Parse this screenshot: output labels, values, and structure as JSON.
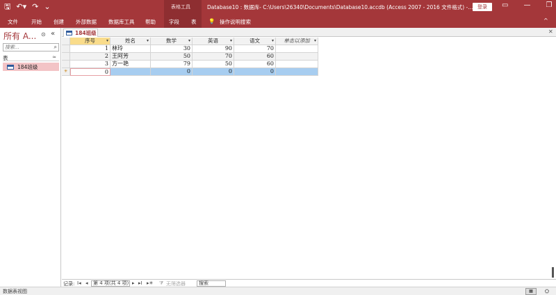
{
  "titlebar": {
    "qat_icons": [
      "save-icon",
      "undo-icon",
      "redo-icon",
      "customize-icon"
    ],
    "qat_glyphs": [
      "🖫",
      "↶▾",
      "↷",
      "⌄"
    ],
    "context_tools": "表格工具",
    "title": "Database10 : 数据库- C:\\Users\\26340\\Documents\\Database10.accdb (Access 2007 - 2016 文件格式) -...",
    "login": "登录",
    "controls": [
      "▭",
      "—",
      "❐",
      "✕"
    ]
  },
  "ribbon": {
    "tabs": [
      "文件",
      "开始",
      "创建",
      "外部数据",
      "数据库工具",
      "帮助",
      "字段",
      "表"
    ],
    "tell_me": "操作说明搜索",
    "tell_me_icon": "💡",
    "collapse": "^"
  },
  "nav": {
    "title": "所有 A...",
    "dropdown": "⊙",
    "collapse": "«",
    "search_placeholder": "搜索...",
    "search_icon": "⌕",
    "group": "表",
    "group_chevron": "≈",
    "items": [
      {
        "label": "184班级"
      }
    ]
  },
  "doc": {
    "tab": "184班级",
    "close": "✕"
  },
  "datasheet": {
    "columns": [
      {
        "label": "序号",
        "key": true
      },
      {
        "label": "姓名"
      },
      {
        "label": "数学"
      },
      {
        "label": "英语"
      },
      {
        "label": "语文"
      },
      {
        "label": "单击以添加",
        "add": true
      }
    ],
    "rows": [
      [
        "1",
        "林玲",
        "30",
        "90",
        "70"
      ],
      [
        "2",
        "王阿芳",
        "50",
        "70",
        "60"
      ],
      [
        "3",
        "方一艳",
        "79",
        "50",
        "60"
      ]
    ],
    "new_row": [
      "0",
      "",
      "0",
      "0",
      "0"
    ],
    "new_marker": "✳"
  },
  "recnav": {
    "label": "记录:",
    "first": "I◂",
    "prev": "◂",
    "position": "第 4 项(共 4 项)",
    "next": "▸",
    "last": "▸I",
    "new": "▸✳",
    "filter": "无筛选器",
    "search": "搜索"
  },
  "status": {
    "text": "数据表视图",
    "view1": "▦",
    "view2": "⛭"
  }
}
